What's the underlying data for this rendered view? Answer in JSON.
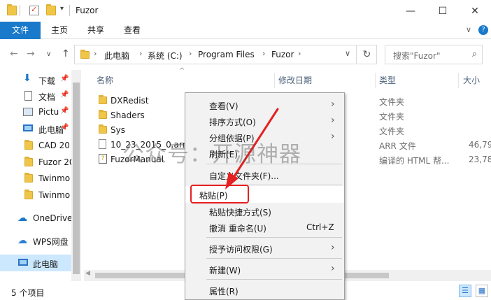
{
  "window": {
    "title": "Fuzor",
    "minimize": "—",
    "maximize": "☐",
    "close": "✕"
  },
  "ribbon": {
    "tabs": [
      "文件",
      "主页",
      "共享",
      "查看"
    ],
    "collapse": "∨",
    "help": "?"
  },
  "nav": {
    "back": "←",
    "forward": "→",
    "recent": "∨",
    "up": "↑",
    "breadcrumb": [
      "此电脑",
      "系统 (C:)",
      "Program Files",
      "Fuzor"
    ],
    "refresh": "↻",
    "search_placeholder": "搜索\"Fuzor\""
  },
  "sidebar": {
    "items": [
      {
        "label": "下载",
        "pinned": true,
        "icon": "download-icon"
      },
      {
        "label": "文档",
        "pinned": true,
        "icon": "document-icon"
      },
      {
        "label": "Pictu",
        "pinned": true,
        "icon": "pictures-icon"
      },
      {
        "label": "此电脑",
        "pinned": true,
        "icon": "computer-icon"
      },
      {
        "label": "CAD 20",
        "pinned": false,
        "icon": "folder-icon"
      },
      {
        "label": "Fuzor 20",
        "pinned": false,
        "icon": "folder-icon"
      },
      {
        "label": "Twinmo",
        "pinned": false,
        "icon": "folder-icon"
      },
      {
        "label": "Twinmo",
        "pinned": false,
        "icon": "folder-icon"
      },
      {
        "label": "OneDrive",
        "pinned": false,
        "icon": "onedrive-icon"
      },
      {
        "label": "WPS网盘",
        "pinned": false,
        "icon": "wps-cloud-icon"
      },
      {
        "label": "此电脑",
        "pinned": false,
        "icon": "computer-icon",
        "selected": true
      }
    ]
  },
  "columns": {
    "name": "名称",
    "date": "修改日期",
    "type": "类型",
    "size": "大小",
    "sort_indicator": "^"
  },
  "files": [
    {
      "name": "DXRedist",
      "type": "文件夹",
      "size": "",
      "icon": "folder-icon"
    },
    {
      "name": "Shaders",
      "type": "文件夹",
      "size": "",
      "icon": "folder-icon"
    },
    {
      "name": "Sys",
      "type": "文件夹",
      "size": "",
      "icon": "folder-icon"
    },
    {
      "name": "10_23_2015_0.arr",
      "type": "ARR 文件",
      "size": "46,79",
      "icon": "file-icon"
    },
    {
      "name": "FuzorManual",
      "type": "编译的 HTML 帮...",
      "size": "23,78",
      "icon": "help-file-icon"
    }
  ],
  "context_menu": {
    "items": [
      {
        "label": "查看(V)",
        "submenu": true
      },
      {
        "label": "排序方式(O)",
        "submenu": true
      },
      {
        "label": "分组依据(P)",
        "submenu": true
      },
      {
        "label": "刷新(E)",
        "submenu": false
      },
      {
        "label": "自定义文件夹(F)...",
        "submenu": false
      },
      {
        "label": "粘贴(P)",
        "submenu": false,
        "highlighted": true
      },
      {
        "label": "粘贴快捷方式(S)",
        "submenu": false
      },
      {
        "label": "撤消 重命名(U)",
        "submenu": false,
        "accelerator": "Ctrl+Z"
      },
      {
        "label": "授予访问权限(G)",
        "submenu": true
      },
      {
        "label": "新建(W)",
        "submenu": true
      },
      {
        "label": "属性(R)",
        "submenu": false
      }
    ]
  },
  "status": {
    "count": "5 个项目"
  },
  "watermark": "公众号：开源神器",
  "colors": {
    "accent": "#1979ca",
    "selection": "#cce8ff",
    "annotation": "#e52020",
    "folder": "#f0c648"
  }
}
